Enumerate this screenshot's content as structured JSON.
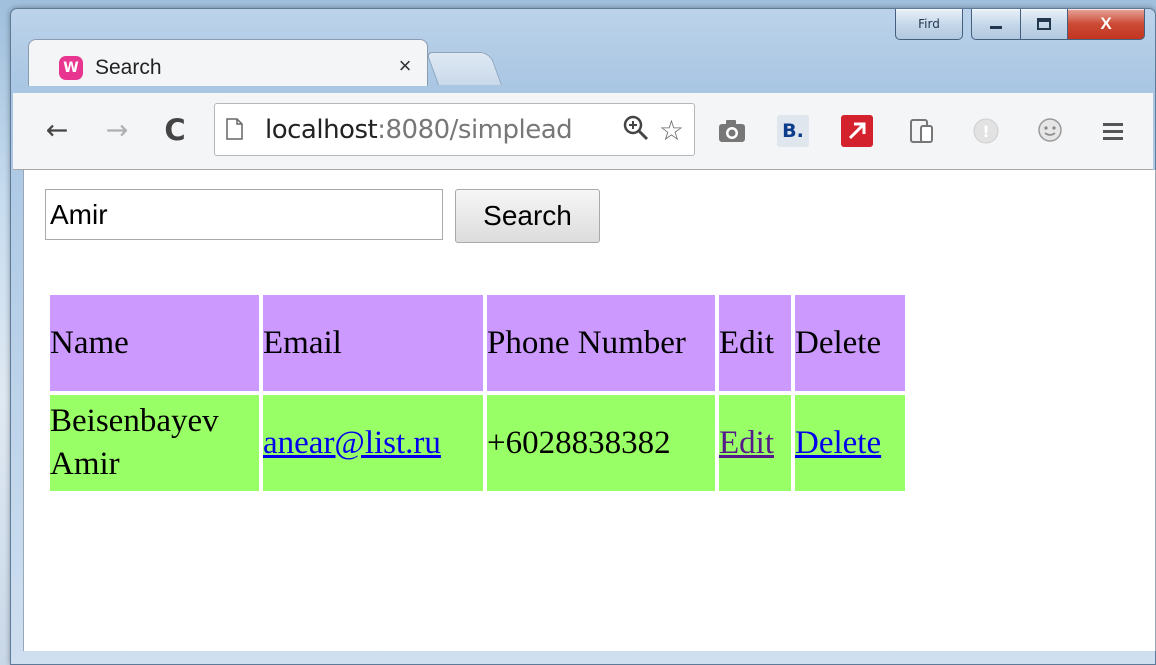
{
  "window": {
    "caption_extra": "Fird",
    "colors": {
      "close_button": "#c23520",
      "frame": "#a9c6e3"
    }
  },
  "tab": {
    "title": "Search",
    "favicon": "W",
    "close": "×"
  },
  "address_bar": {
    "host": "localhost",
    "rest": ":8080/simplead"
  },
  "nav": {
    "back": "←",
    "forward": "→",
    "reload": "C"
  },
  "search": {
    "value": "Amir",
    "button_label": "Search"
  },
  "table": {
    "headers": [
      "Name",
      "Email",
      "Phone Number",
      "Edit",
      "Delete"
    ],
    "rows": [
      {
        "name": "Beisenbayev Amir",
        "email": "anear@list.ru",
        "phone": "+6028838382",
        "edit": "Edit",
        "delete": "Delete"
      }
    ],
    "colors": {
      "header_bg": "#cc99ff",
      "row_bg": "#99ff66"
    }
  },
  "extensions": [
    "camera-icon",
    "b-icon",
    "red-arrow-icon",
    "device-icon",
    "exclamation-icon",
    "face-icon",
    "menu-icon"
  ]
}
